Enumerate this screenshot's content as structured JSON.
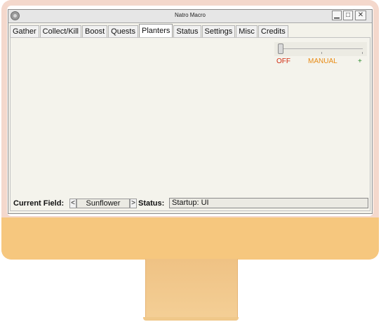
{
  "window": {
    "title": "Natro Macro",
    "controls": {
      "minimize": "▁",
      "maximize": "□",
      "close": "✕"
    }
  },
  "tabs": [
    {
      "label": "Gather"
    },
    {
      "label": "Collect/Kill"
    },
    {
      "label": "Boost"
    },
    {
      "label": "Quests"
    },
    {
      "label": "Planters",
      "active": true
    },
    {
      "label": "Status"
    },
    {
      "label": "Settings"
    },
    {
      "label": "Misc"
    },
    {
      "label": "Credits"
    }
  ],
  "planters": {
    "mode_slider": {
      "labels": {
        "off": "OFF",
        "manual": "MANUAL",
        "plus": "+"
      },
      "value_label": "OFF"
    }
  },
  "status_bar": {
    "current_field_label": "Current Field:",
    "prev_field": "<",
    "next_field": ">",
    "field_value": "Sunflower",
    "status_label": "Status:",
    "status_value": "Startup: UI"
  },
  "colors": {
    "off": "#d12b10",
    "manual": "#e88b14",
    "plus": "#2a8a2a",
    "monitor_body": "#f6c77e"
  },
  "icons": [
    "app-icon",
    "minimize-icon",
    "maximize-icon",
    "close-icon",
    "monitor-frame"
  ]
}
